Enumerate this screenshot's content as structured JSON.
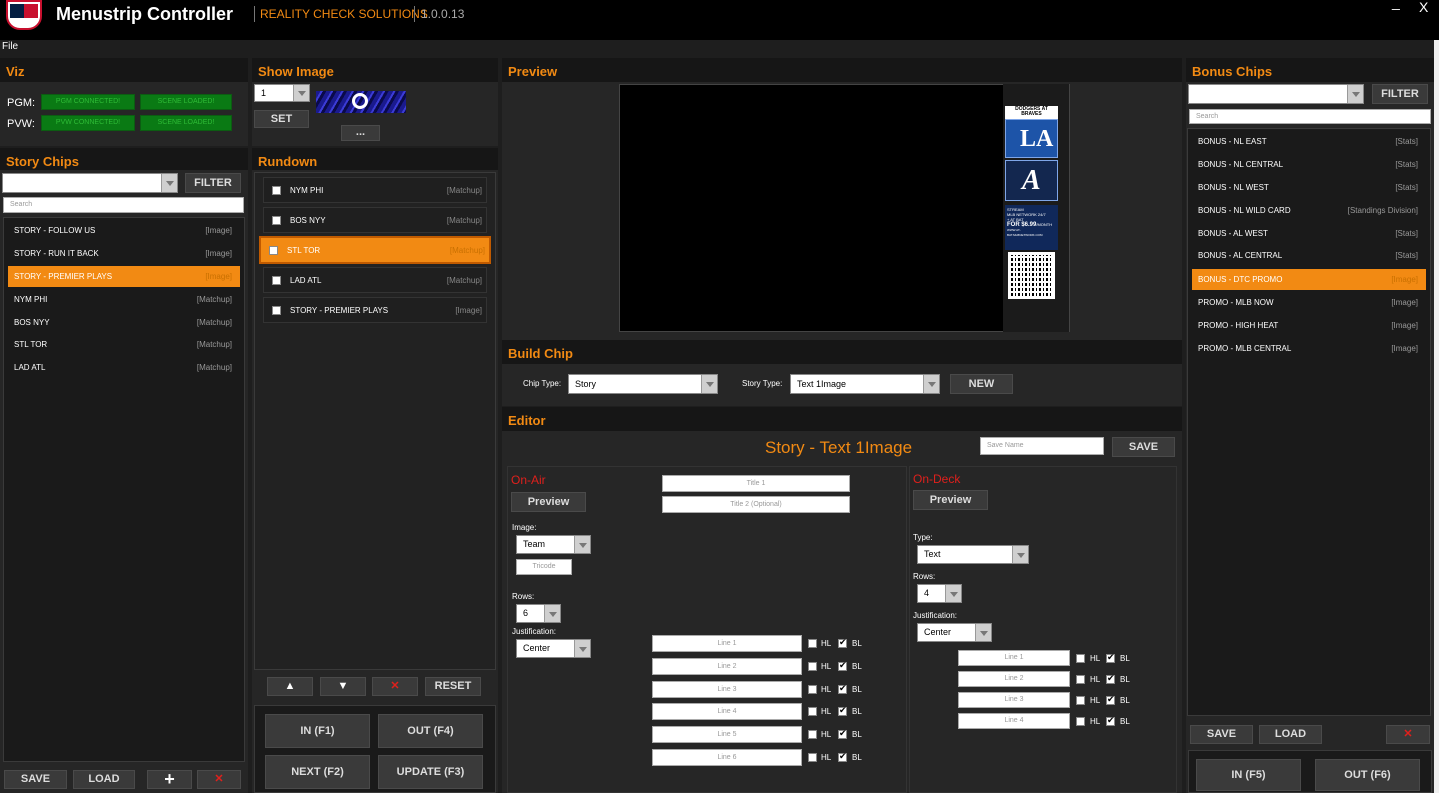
{
  "app": {
    "title": "Menustrip Controller",
    "company": "REALITY CHECK SOLUTIONS",
    "version": "1.0.0.13",
    "min": "_",
    "close": "X"
  },
  "menu": {
    "file": "File"
  },
  "viz": {
    "title": "Viz",
    "pgm": "PGM:",
    "pvw": "PVW:",
    "pgm_conn": "PGM CONNECTED!",
    "pgm_scene": "SCENE LOADED!",
    "pvw_conn": "PVW CONNECTED!",
    "pvw_scene": "SCENE LOADED!"
  },
  "show_image": {
    "title": "Show Image",
    "value": "1",
    "set": "SET",
    "browse": "..."
  },
  "story": {
    "title": "Story Chips",
    "filter": "FILTER",
    "search": "Search",
    "items": [
      {
        "label": "STORY - FOLLOW US",
        "tag": "[Image]"
      },
      {
        "label": "STORY - RUN IT BACK",
        "tag": "[Image]"
      },
      {
        "label": "STORY - PREMIER PLAYS",
        "tag": "[Image]"
      },
      {
        "label": "NYM PHI",
        "tag": "[Matchup]"
      },
      {
        "label": "BOS NYY",
        "tag": "[Matchup]"
      },
      {
        "label": "STL TOR",
        "tag": "[Matchup]"
      },
      {
        "label": "LAD ATL",
        "tag": "[Matchup]"
      }
    ],
    "save": "SAVE",
    "load": "LOAD",
    "add": "+",
    "del": "✕"
  },
  "rundown": {
    "title": "Rundown",
    "items": [
      {
        "label": "NYM PHI",
        "tag": "[Matchup]"
      },
      {
        "label": "BOS NYY",
        "tag": "[Matchup]"
      },
      {
        "label": "STL TOR",
        "tag": "[Matchup]"
      },
      {
        "label": "LAD ATL",
        "tag": "[Matchup]"
      },
      {
        "label": "STORY - PREMIER PLAYS",
        "tag": "[Image]"
      }
    ],
    "up": "▲",
    "down": "▼",
    "del": "✕",
    "reset": "RESET",
    "in": "IN (F1)",
    "out": "OUT (F4)",
    "next": "NEXT (F2)",
    "update": "UPDATE (F3)"
  },
  "preview": {
    "title": "Preview",
    "chip_head": "DODGERS AT BRAVES",
    "la": "LA",
    "stream1": "STREAM",
    "stream2": "MLB NETWORK 24/7",
    "stream3": "+ AT BAT",
    "stream4": "FOR $6.99",
    "stream5": "/MONTH",
    "stream6": "WWW.AT-BAT.MLBNETWORK.COM"
  },
  "build": {
    "title": "Build Chip",
    "chip_type_label": "Chip Type:",
    "chip_type": "Story",
    "story_type_label": "Story Type:",
    "story_type": "Text 1Image",
    "new": "NEW"
  },
  "editor": {
    "title": "Editor",
    "heading": "Story - Text 1Image",
    "save_name": "Save Name",
    "save": "SAVE",
    "onair": "On-Air",
    "preview": "Preview",
    "title1": "Title 1",
    "title2": "Title 2 (Optional)",
    "image": "Image:",
    "image_val": "Team",
    "tricode": "Tricode",
    "rows": "Rows:",
    "rows_val": "6",
    "just": "Justification:",
    "just_val": "Center",
    "lines": [
      "Line 1",
      "Line 2",
      "Line 3",
      "Line 4",
      "Line 5",
      "Line 6"
    ],
    "hl": "HL",
    "bl": "BL",
    "ondeck": "On-Deck",
    "od_preview": "Preview",
    "type": "Type:",
    "type_val": "Text",
    "od_rows": "Rows:",
    "od_rows_val": "4",
    "od_just": "Justification:",
    "od_just_val": "Center",
    "od_lines": [
      "Line 1",
      "Line 2",
      "Line 3",
      "Line 4"
    ]
  },
  "bonus": {
    "title": "Bonus Chips",
    "filter": "FILTER",
    "search": "Search",
    "items": [
      {
        "label": "BONUS - NL EAST",
        "tag": "[Stats]"
      },
      {
        "label": "BONUS - NL CENTRAL",
        "tag": "[Stats]"
      },
      {
        "label": "BONUS - NL WEST",
        "tag": "[Stats]"
      },
      {
        "label": "BONUS - NL WILD CARD",
        "tag": "[Standings Division]"
      },
      {
        "label": "BONUS - AL WEST",
        "tag": "[Stats]"
      },
      {
        "label": "BONUS - AL CENTRAL",
        "tag": "[Stats]"
      },
      {
        "label": "BONUS - DTC PROMO",
        "tag": "[Image]"
      },
      {
        "label": "PROMO - MLB NOW",
        "tag": "[Image]"
      },
      {
        "label": "PROMO - HIGH HEAT",
        "tag": "[Image]"
      },
      {
        "label": "PROMO - MLB CENTRAL",
        "tag": "[Image]"
      }
    ],
    "save": "SAVE",
    "load": "LOAD",
    "del": "✕",
    "in": "IN (F5)",
    "out": "OUT (F6)"
  },
  "colors": {
    "accent": "#f28a13",
    "red": "#e0201c",
    "green": "#0a7a14"
  }
}
